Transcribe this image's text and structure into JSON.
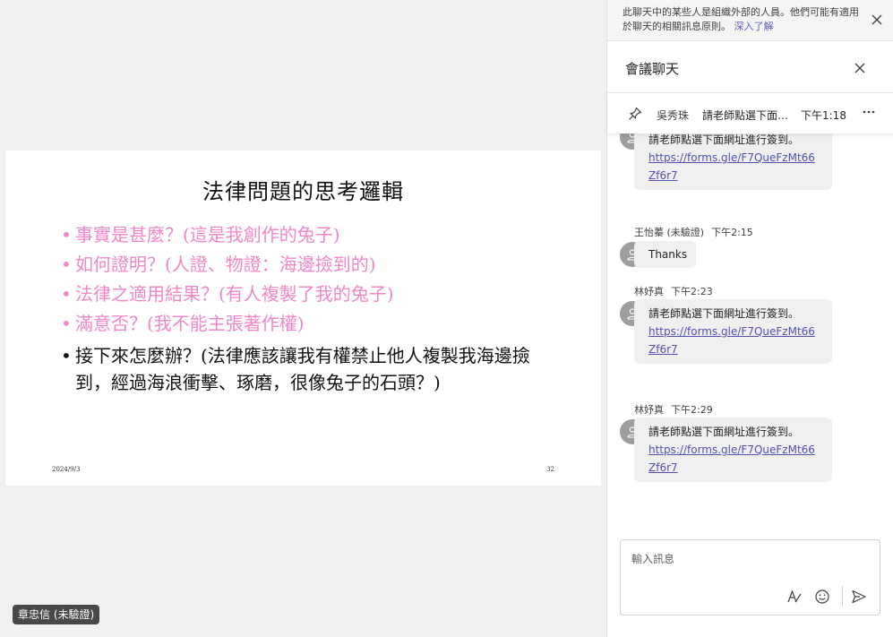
{
  "stage": {
    "presenter_tag": "章忠信 (未驗證)",
    "slide": {
      "title": "法律問題的思考邏輯",
      "bullets": [
        "事實是甚麼？(這是我創作的兔子)",
        "如何證明？(人證、物證：海邊撿到的)",
        "法律之適用結果？(有人複製了我的兔子)",
        "滿意否？(我不能主張著作權)",
        "接下來怎麼辦？(法律應該讓我有權禁止他人複製我海邊撿到，經過海浪衝擊、琢磨，很像兔子的石頭？)"
      ],
      "bullet_colors": [
        "#f087c9",
        "#f087c9",
        "#f087c9",
        "#f087c9",
        "#111111"
      ],
      "date": "2024/9/3",
      "page": "32"
    }
  },
  "chat": {
    "banner": {
      "text": "此聊天中的某些人是組織外部的人員。他們可能有適用於聊天的相關訊息原則。",
      "link": "深入了解"
    },
    "title": "會議聊天",
    "pinned": {
      "sender": "吳秀珠",
      "preview": "請老師點選下面網址進行簽到。",
      "time": "下午1:18"
    },
    "messages": [
      {
        "sender": "",
        "time": "",
        "text": "請老師點選下面網址進行簽到。",
        "link": "https://forms.gle/F7QueFzMt66Zf6r7"
      },
      {
        "sender": "王怡蓁 (未驗證)",
        "time": "下午2:15",
        "text": "Thanks",
        "link": ""
      },
      {
        "sender": "林妤真",
        "time": "下午2:23",
        "text": "請老師點選下面網址進行簽到。",
        "link": "https://forms.gle/F7QueFzMt66Zf6r7"
      },
      {
        "sender": "林妤真",
        "time": "下午2:29",
        "text": "請老師點選下面網址進行簽到。",
        "link": "https://forms.gle/F7QueFzMt66Zf6r7"
      }
    ],
    "composer": {
      "placeholder": "輸入訊息"
    },
    "icons": {
      "close": "close-icon",
      "pin": "pin-icon",
      "more": "more-icon",
      "avatar": "person-icon",
      "format": "format-icon",
      "emoji": "emoji-icon",
      "send": "send-icon"
    },
    "colors": {
      "accent": "#5b5fc7",
      "link": "#4f52b2",
      "bubble": "#f0f0f0",
      "slide_pink": "#f087c9"
    }
  }
}
